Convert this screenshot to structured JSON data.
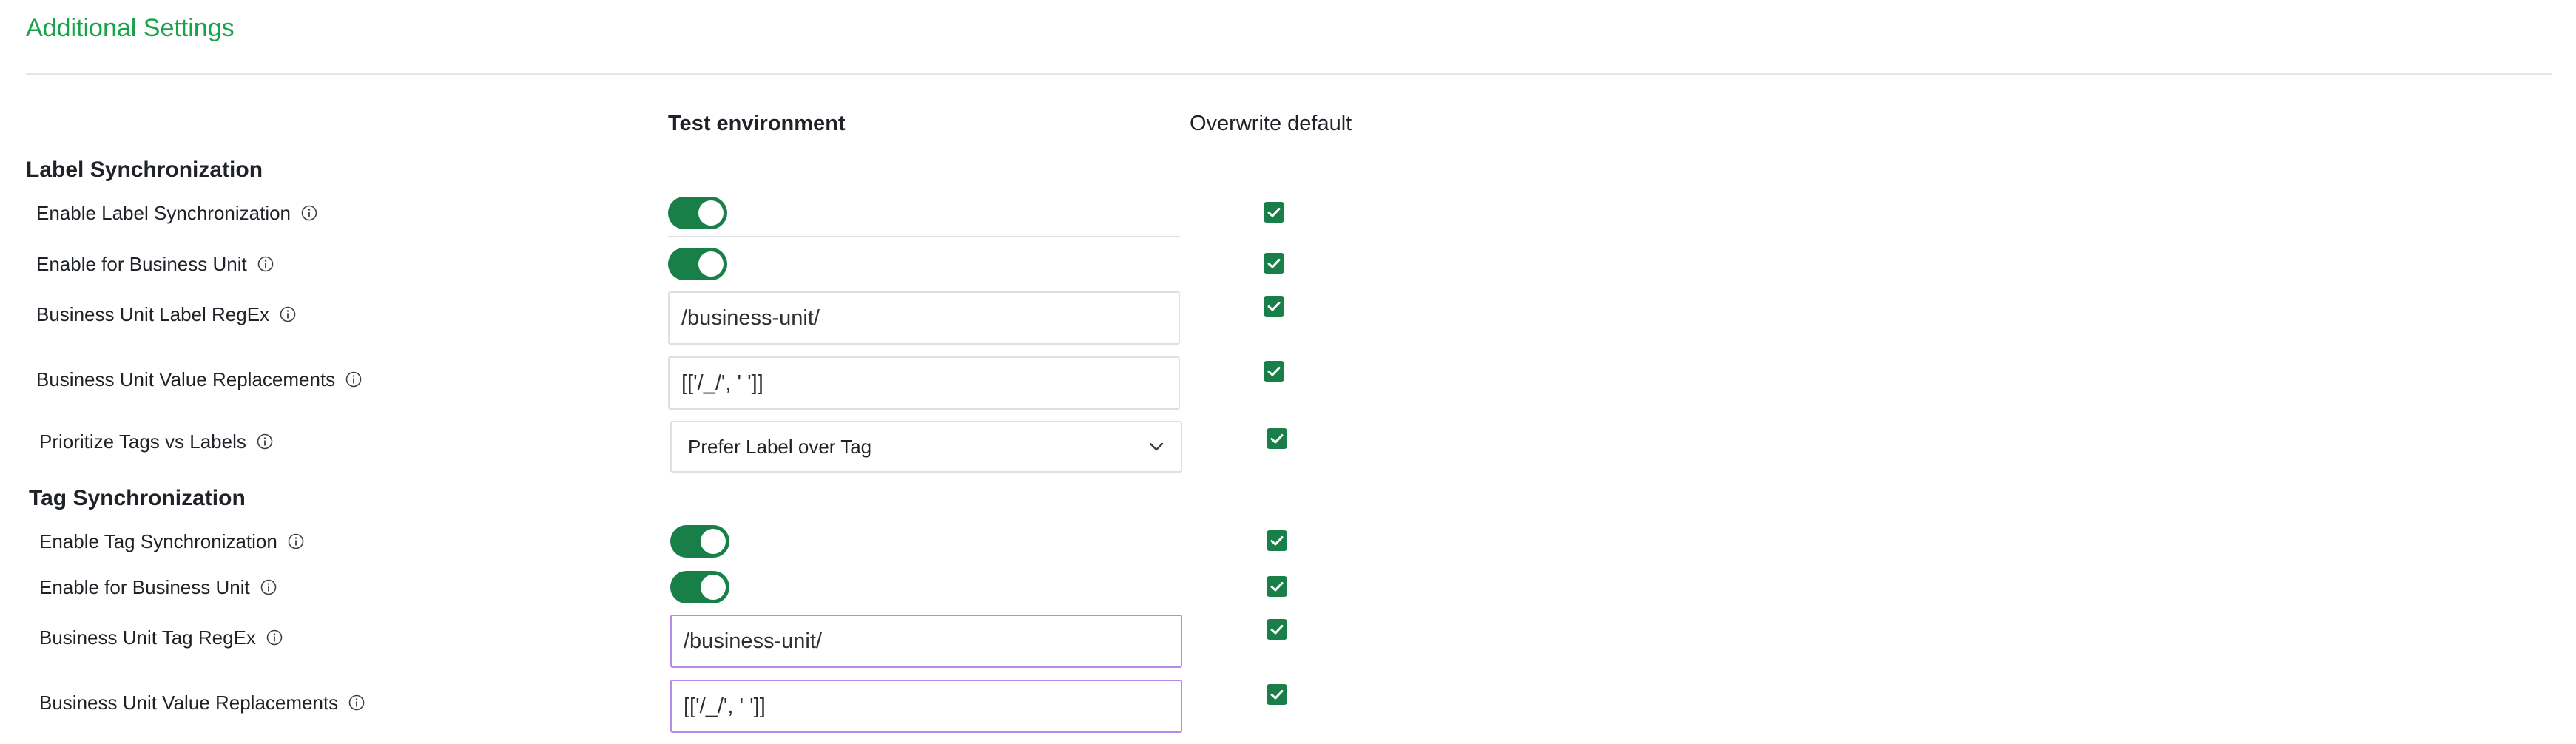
{
  "page": {
    "title": "Additional Settings"
  },
  "columns": {
    "test_environment": "Test environment",
    "overwrite_default": "Overwrite default"
  },
  "label_sync": {
    "title": "Label Synchronization",
    "enable": {
      "label": "Enable Label Synchronization",
      "on": true,
      "overwrite": true
    },
    "enable_bu": {
      "label": "Enable for Business Unit",
      "on": true,
      "overwrite": true
    },
    "bu_regex": {
      "label": "Business Unit Label RegEx",
      "value": "/business-unit/",
      "overwrite": true
    },
    "bu_replacements": {
      "label": "Business Unit Value Replacements",
      "value": "[['/_/', ' ']]",
      "overwrite": true
    },
    "prioritize": {
      "label": "Prioritize Tags vs Labels",
      "selected": "Prefer Label over Tag",
      "overwrite": true
    }
  },
  "tag_sync": {
    "title": "Tag Synchronization",
    "enable": {
      "label": "Enable Tag Synchronization",
      "on": true,
      "overwrite": true
    },
    "enable_bu": {
      "label": "Enable for Business Unit",
      "on": true,
      "overwrite": true
    },
    "bu_regex": {
      "label": "Business Unit Tag RegEx",
      "value": "/business-unit/",
      "overwrite": true
    },
    "bu_replacements": {
      "label": "Business Unit Value Replacements",
      "value": "[['/_/', ' ']]",
      "overwrite": true
    }
  },
  "colors": {
    "accent_green": "#177f47",
    "title_green": "#17a34a",
    "focus_purple": "#b68ae6"
  },
  "icons": {
    "info": "info-circle-icon",
    "check": "checkmark-icon",
    "dropdown": "chevron-down-icon"
  }
}
